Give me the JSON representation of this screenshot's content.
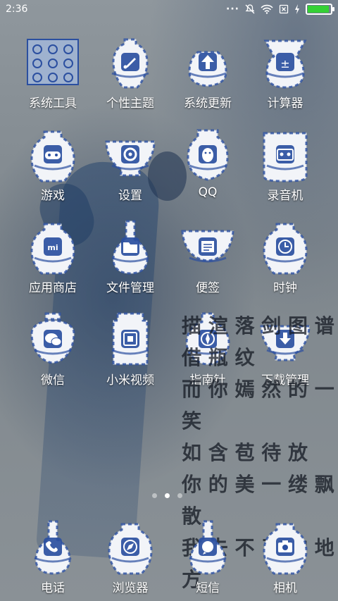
{
  "status_bar": {
    "time": "2:36",
    "battery_level": 1.0
  },
  "apps": [
    [
      {
        "label": "系统工具",
        "icon": "grid-folder-icon",
        "shape": "box"
      },
      {
        "label": "个性主题",
        "icon": "brush-icon",
        "shape": "meiping"
      },
      {
        "label": "系统更新",
        "icon": "up-arrow-icon",
        "shape": "teapot"
      },
      {
        "label": "计算器",
        "icon": "calculator-icon",
        "shape": "zhadou"
      }
    ],
    [
      {
        "label": "游戏",
        "icon": "gamepad-icon",
        "shape": "jar"
      },
      {
        "label": "设置",
        "icon": "gear-icon",
        "shape": "bowl"
      },
      {
        "label": "QQ",
        "icon": "penguin-icon",
        "shape": "ewer"
      },
      {
        "label": "录音机",
        "icon": "cassette-icon",
        "shape": "brushpot"
      }
    ],
    [
      {
        "label": "应用商店",
        "icon": "mi-store-icon",
        "shape": "jar"
      },
      {
        "label": "文件管理",
        "icon": "folder-icon",
        "shape": "bottle"
      },
      {
        "label": "便签",
        "icon": "note-icon",
        "shape": "basin"
      },
      {
        "label": "时钟",
        "icon": "clock-icon",
        "shape": "jar"
      }
    ],
    [
      {
        "label": "微信",
        "icon": "chat-bubble-icon",
        "shape": "lidjar"
      },
      {
        "label": "小米视频",
        "icon": "film-icon",
        "shape": "square"
      },
      {
        "label": "指南针",
        "icon": "compass-icon",
        "shape": "moonflask"
      },
      {
        "label": "下载管理",
        "icon": "download-icon",
        "shape": "bowl"
      }
    ]
  ],
  "dock": [
    {
      "label": "电话",
      "icon": "phone-icon",
      "shape": "bottle"
    },
    {
      "label": "浏览器",
      "icon": "compass-browser-icon",
      "shape": "jar"
    },
    {
      "label": "短信",
      "icon": "message-icon",
      "shape": "bottle"
    },
    {
      "label": "相机",
      "icon": "camera-icon",
      "shape": "jar"
    }
  ],
  "poem_lines": [
    "描 渲 落 剑 图 谱",
    "借 瓶 纹",
    "而 你 嫣 然 的 一 笑",
    "如 含 苞 待 放",
    "你 的 美 一 缕 飘 散",
    "我 去 不 了 的 地 方"
  ],
  "page_indicator": {
    "count": 3,
    "active": 1
  },
  "colors": {
    "porcelain_blue": "#2b4fa0",
    "porcelain_white": "#f2f4f8",
    "battery": "#35d035"
  }
}
